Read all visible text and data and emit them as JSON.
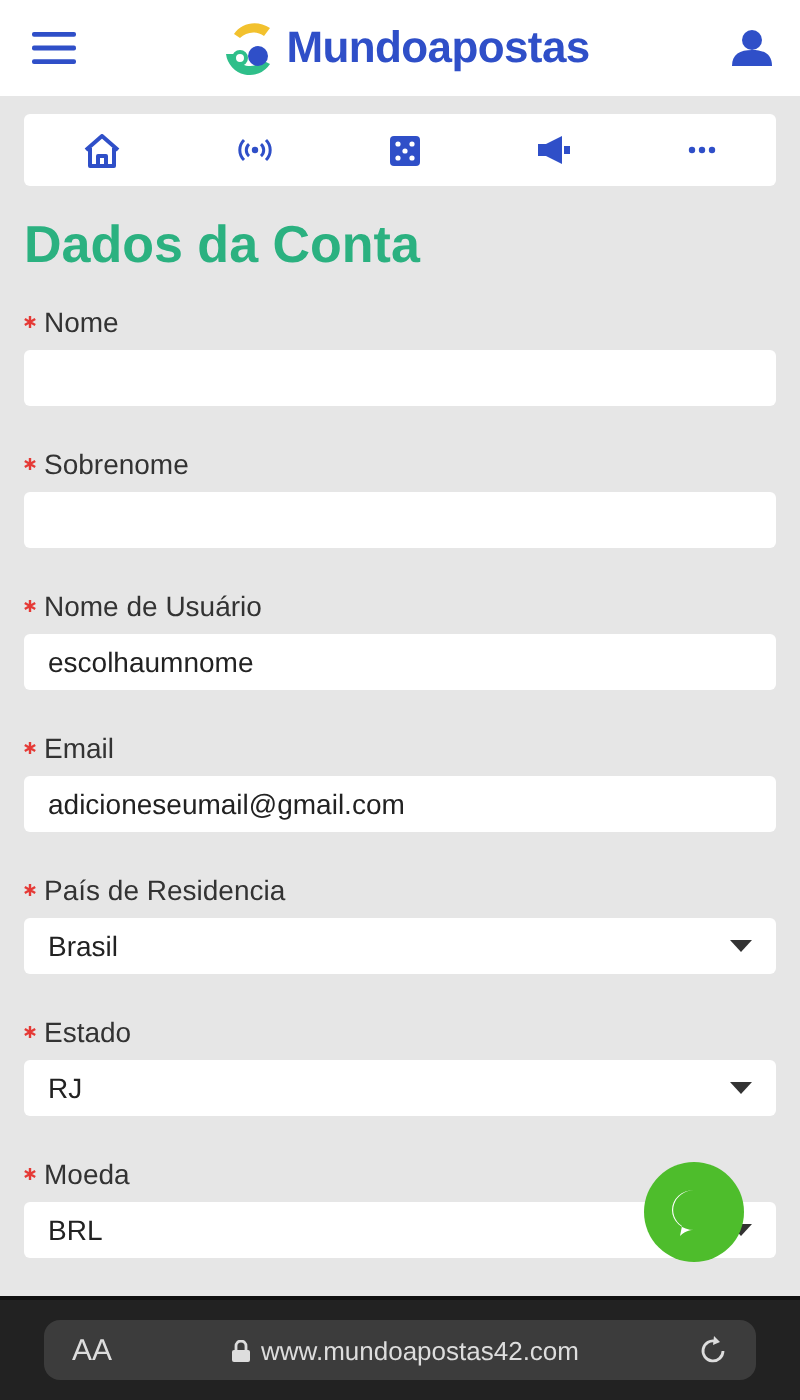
{
  "header": {
    "logo_text": "Mundoapostas"
  },
  "nav": [
    {
      "kind": "home"
    },
    {
      "kind": "live"
    },
    {
      "kind": "dice"
    },
    {
      "kind": "promo"
    },
    {
      "kind": "more"
    }
  ],
  "page_title": "Dados da Conta",
  "fields": [
    {
      "kind": "text",
      "label": "Nome",
      "required": true
    },
    {
      "kind": "text",
      "label": "Sobrenome",
      "required": true
    },
    {
      "kind": "text",
      "label": "Nome de Usuário",
      "required": true,
      "value": "escolhaumnome"
    },
    {
      "kind": "text",
      "label": "Email",
      "required": true,
      "value": "adicioneseumail@gmail.com"
    },
    {
      "kind": "select",
      "label": "País de Residencia",
      "required": true,
      "value": "Brasil"
    },
    {
      "kind": "select",
      "label": "Estado",
      "required": true,
      "value": "RJ"
    },
    {
      "kind": "select",
      "label": "Moeda",
      "required": true,
      "value": "BRL"
    }
  ],
  "browser_bar": {
    "text_size_label": "AA",
    "url": "www.mundoapostas42.com"
  }
}
